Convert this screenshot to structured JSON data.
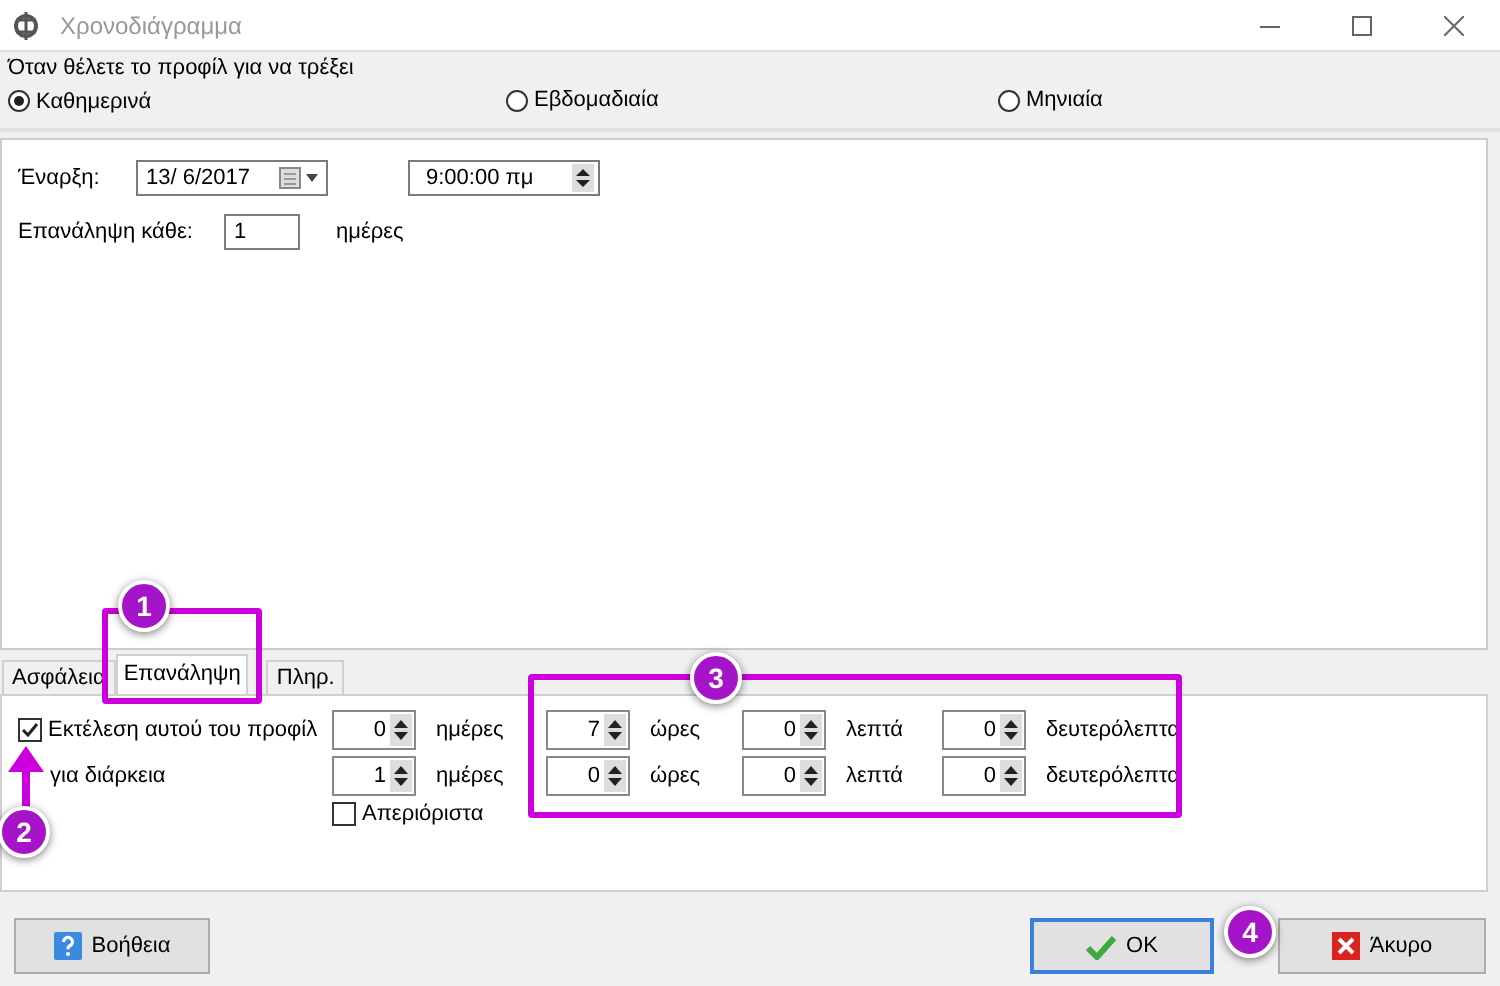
{
  "window": {
    "title": "Χρονοδιάγραμμα"
  },
  "schedule_group": {
    "label": "Όταν θέλετε το προφίλ για να τρέξει",
    "options": [
      {
        "label": "Καθημερινά",
        "selected": true
      },
      {
        "label": "Εβδομαδιαία",
        "selected": false
      },
      {
        "label": "Μηνιαία",
        "selected": false
      }
    ]
  },
  "start": {
    "label": "Έναρξη:",
    "date": "13/ 6/2017",
    "time": "9:00:00 πμ"
  },
  "repeat_every": {
    "label": "Επανάληψη κάθε:",
    "value": "1",
    "unit": "ημέρες"
  },
  "tabs": [
    {
      "label": "Ασφάλεια",
      "selected": false
    },
    {
      "label": "Επανάληψη",
      "selected": true
    },
    {
      "label": "Πληρ.",
      "selected": false
    }
  ],
  "repeat_rows": [
    {
      "kind": "checkbox",
      "label": "Εκτέλεση αυτού του προφίλ",
      "checked": true,
      "fields": [
        {
          "value": "0",
          "unit": "ημέρες"
        },
        {
          "value": "7",
          "unit": "ώρες"
        },
        {
          "value": "0",
          "unit": "λεπτά"
        },
        {
          "value": "0",
          "unit": "δευτερόλεπτα"
        }
      ]
    },
    {
      "kind": "label",
      "label": "για διάρκεια",
      "fields": [
        {
          "value": "1",
          "unit": "ημέρες"
        },
        {
          "value": "0",
          "unit": "ώρες"
        },
        {
          "value": "0",
          "unit": "λεπτά"
        },
        {
          "value": "0",
          "unit": "δευτερόλεπτα"
        }
      ]
    }
  ],
  "unlimited": {
    "label": "Απεριόριστα",
    "checked": false
  },
  "buttons": [
    {
      "kind": "help",
      "label": "Βοήθεια",
      "default": false
    },
    {
      "kind": "ok",
      "label": "OK",
      "default": true
    },
    {
      "kind": "cancel",
      "label": "Άκυρο",
      "default": false
    }
  ],
  "annotations": [
    {
      "number": "1"
    },
    {
      "number": "2"
    },
    {
      "number": "3"
    },
    {
      "number": "4"
    }
  ]
}
